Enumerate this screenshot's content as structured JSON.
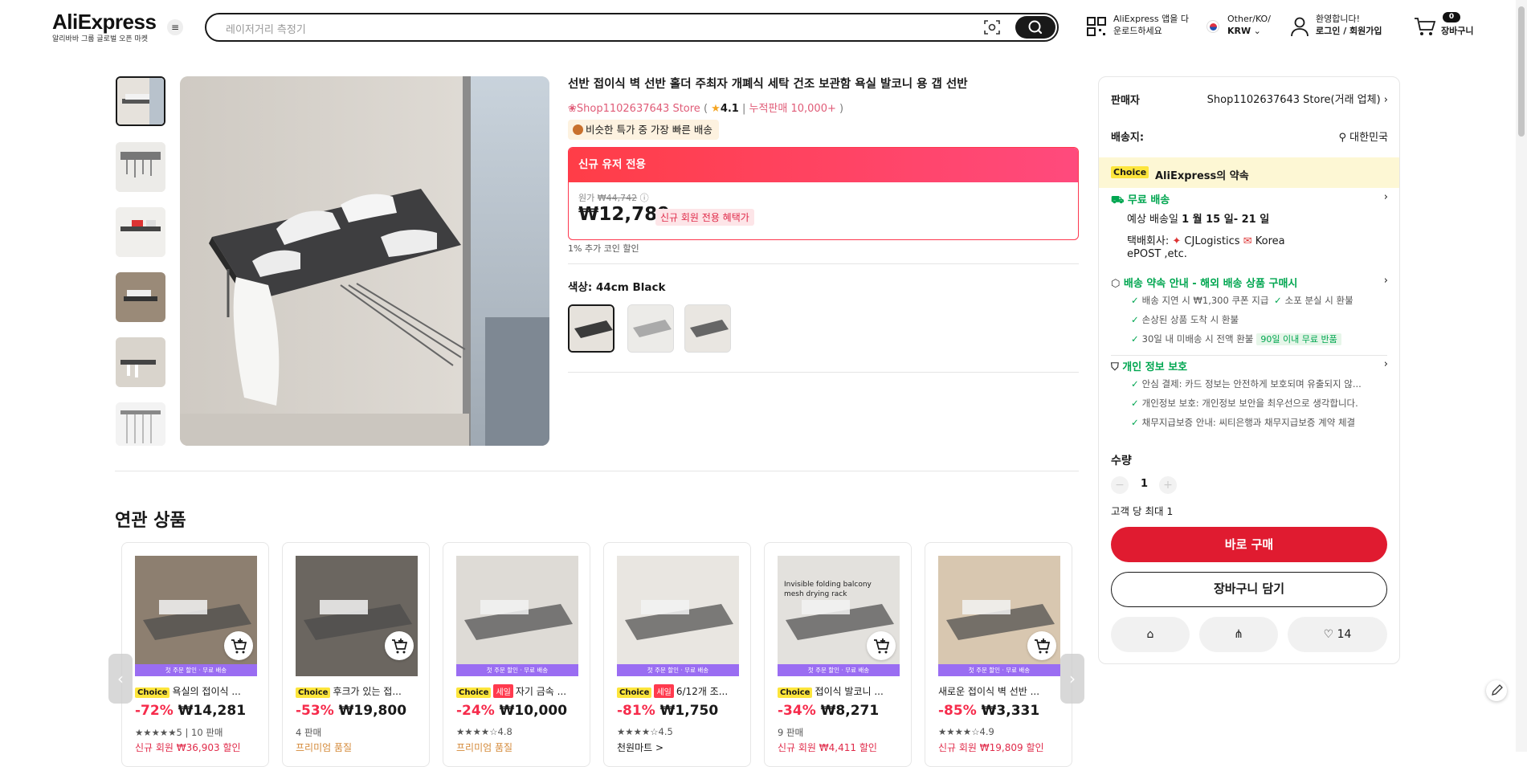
{
  "header": {
    "logo": "AliExpress",
    "logo_sub": "알리바바 그룹 글로벌 오픈 마켓",
    "menu_icon": "hamburger-icon",
    "search_placeholder": "레이저거리 측정기",
    "app_line1": "AliExpress 앱을 다",
    "app_line2": "운로드하세요",
    "region_line1": "Other/KO/",
    "region_line2": "KRW",
    "user_line1": "환영합니다!",
    "user_line2": "로그인 / 회원가입",
    "cart_count": "0",
    "cart_label": "장바구니"
  },
  "product": {
    "title": "선반 접이식 벽 선반 홀더 주최자 개폐식 세탁 건조 보관함 욕실 발코니 용 갭 선반",
    "store": "Shop1102637643 Store",
    "rating": "4.1",
    "sold": "누적판매 10,000+",
    "deal_tag": "비슷한 특가 중 가장 빠른 배송",
    "promo_header": "신규 유저 전용",
    "original_label": "원가",
    "original_price": "₩44,742",
    "price": "₩12,789",
    "price_note": "신규 회원 전용 혜택가",
    "coin_discount": "1% 추가 코인 할인",
    "color_label": "색상: 44cm Black"
  },
  "related": {
    "title": "연관 상품",
    "items": [
      {
        "band": "첫 주문 할인 · 무료 배송",
        "badges": [
          "Choice"
        ],
        "sale": "",
        "name": "욕실의 접이식 ...",
        "discount": "-72%",
        "price": "₩14,281",
        "meta": "★★★★★5 | 10 판매",
        "extra": "신규 회원 ₩36,903 할인"
      },
      {
        "band": "",
        "badges": [
          "Choice"
        ],
        "sale": "",
        "name": "후크가 있는 접...",
        "discount": "-53%",
        "price": "₩19,800",
        "meta": "4 판매",
        "extra": "프리미엄 품질"
      },
      {
        "band": "첫 주문 할인 · 무료 배송",
        "badges": [
          "Choice"
        ],
        "sale": "세일",
        "name": "자기 금속 ...",
        "discount": "-24%",
        "price": "₩10,000",
        "meta": "★★★★☆4.8",
        "extra": "프리미엄 품질"
      },
      {
        "band": "첫 주문 할인 · 무료 배송",
        "badges": [
          "Choice"
        ],
        "sale": "세일",
        "name": "6/12개 조...",
        "discount": "-81%",
        "price": "₩1,750",
        "meta": "★★★★☆4.5",
        "extra": "천원마트 >"
      },
      {
        "band": "첫 주문 할인 · 무료 배송",
        "badges": [
          "Choice"
        ],
        "sale": "",
        "name": "접이식 발코니 ...",
        "discount": "-34%",
        "price": "₩8,271",
        "meta": "9 판매",
        "extra": "신규 회원 ₩4,411 할인"
      },
      {
        "band": "첫 주문 할인 · 무료 배송",
        "badges": [],
        "sale": "",
        "name": "새로운 접이식 벽 선반 ...",
        "discount": "-85%",
        "price": "₩3,331",
        "meta": "★★★★☆4.9",
        "extra": "신규 회원 ₩19,809 할인"
      }
    ],
    "card_image_text": "Invisible folding balcony mesh drying rack"
  },
  "panel": {
    "seller_label": "판매자",
    "seller_value": "Shop1102637643 Store(거래 업체)",
    "ship_to_label": "배송지:",
    "ship_to_value": "대한민국",
    "choice_badge": "Choice",
    "choice_text": "AliExpress의 약속",
    "free_ship": "무료 배송",
    "eta_prefix": "예상 배송일",
    "eta": "1 월 15 일- 21 일",
    "carrier_label": "택배회사:",
    "carrier_1": "CJLogistics",
    "carrier_2": "Korea",
    "carrier_3": "ePOST ,etc.",
    "promise_title": "배송 약속 안내 - 해외 배송 상품 구매시",
    "promise_1": "배송 지연 시 ₩1,300 쿠폰 지급",
    "promise_2": "소포 분실 시 환불",
    "promise_3": "손상된 상품 도착 시 환불",
    "promise_4": "30일 내 미배송 시 전액 환불",
    "promise_tag": "90일 이내 무료 반품",
    "privacy_title": "개인 정보 보호",
    "privacy_1": "안심 결제: 카드 정보는 안전하게 보호되며 유출되지 않...",
    "privacy_2": "개인정보 보호: 개인정보 보안을 최우선으로 생각합니다.",
    "privacy_3": "채무지급보증 안내: 씨티은행과 채무지급보증 계약 체결",
    "qty_label": "수량",
    "qty_value": "1",
    "qty_limit": "고객 당 최대 1",
    "buy_now": "바로 구매",
    "add_cart": "장바구니 담기",
    "wish_count": "14"
  },
  "colors": {
    "accent_red": "#e01b30",
    "promo_pink": "#ff4a7d",
    "green": "#00a650",
    "choice_yellow": "#fde53c"
  }
}
